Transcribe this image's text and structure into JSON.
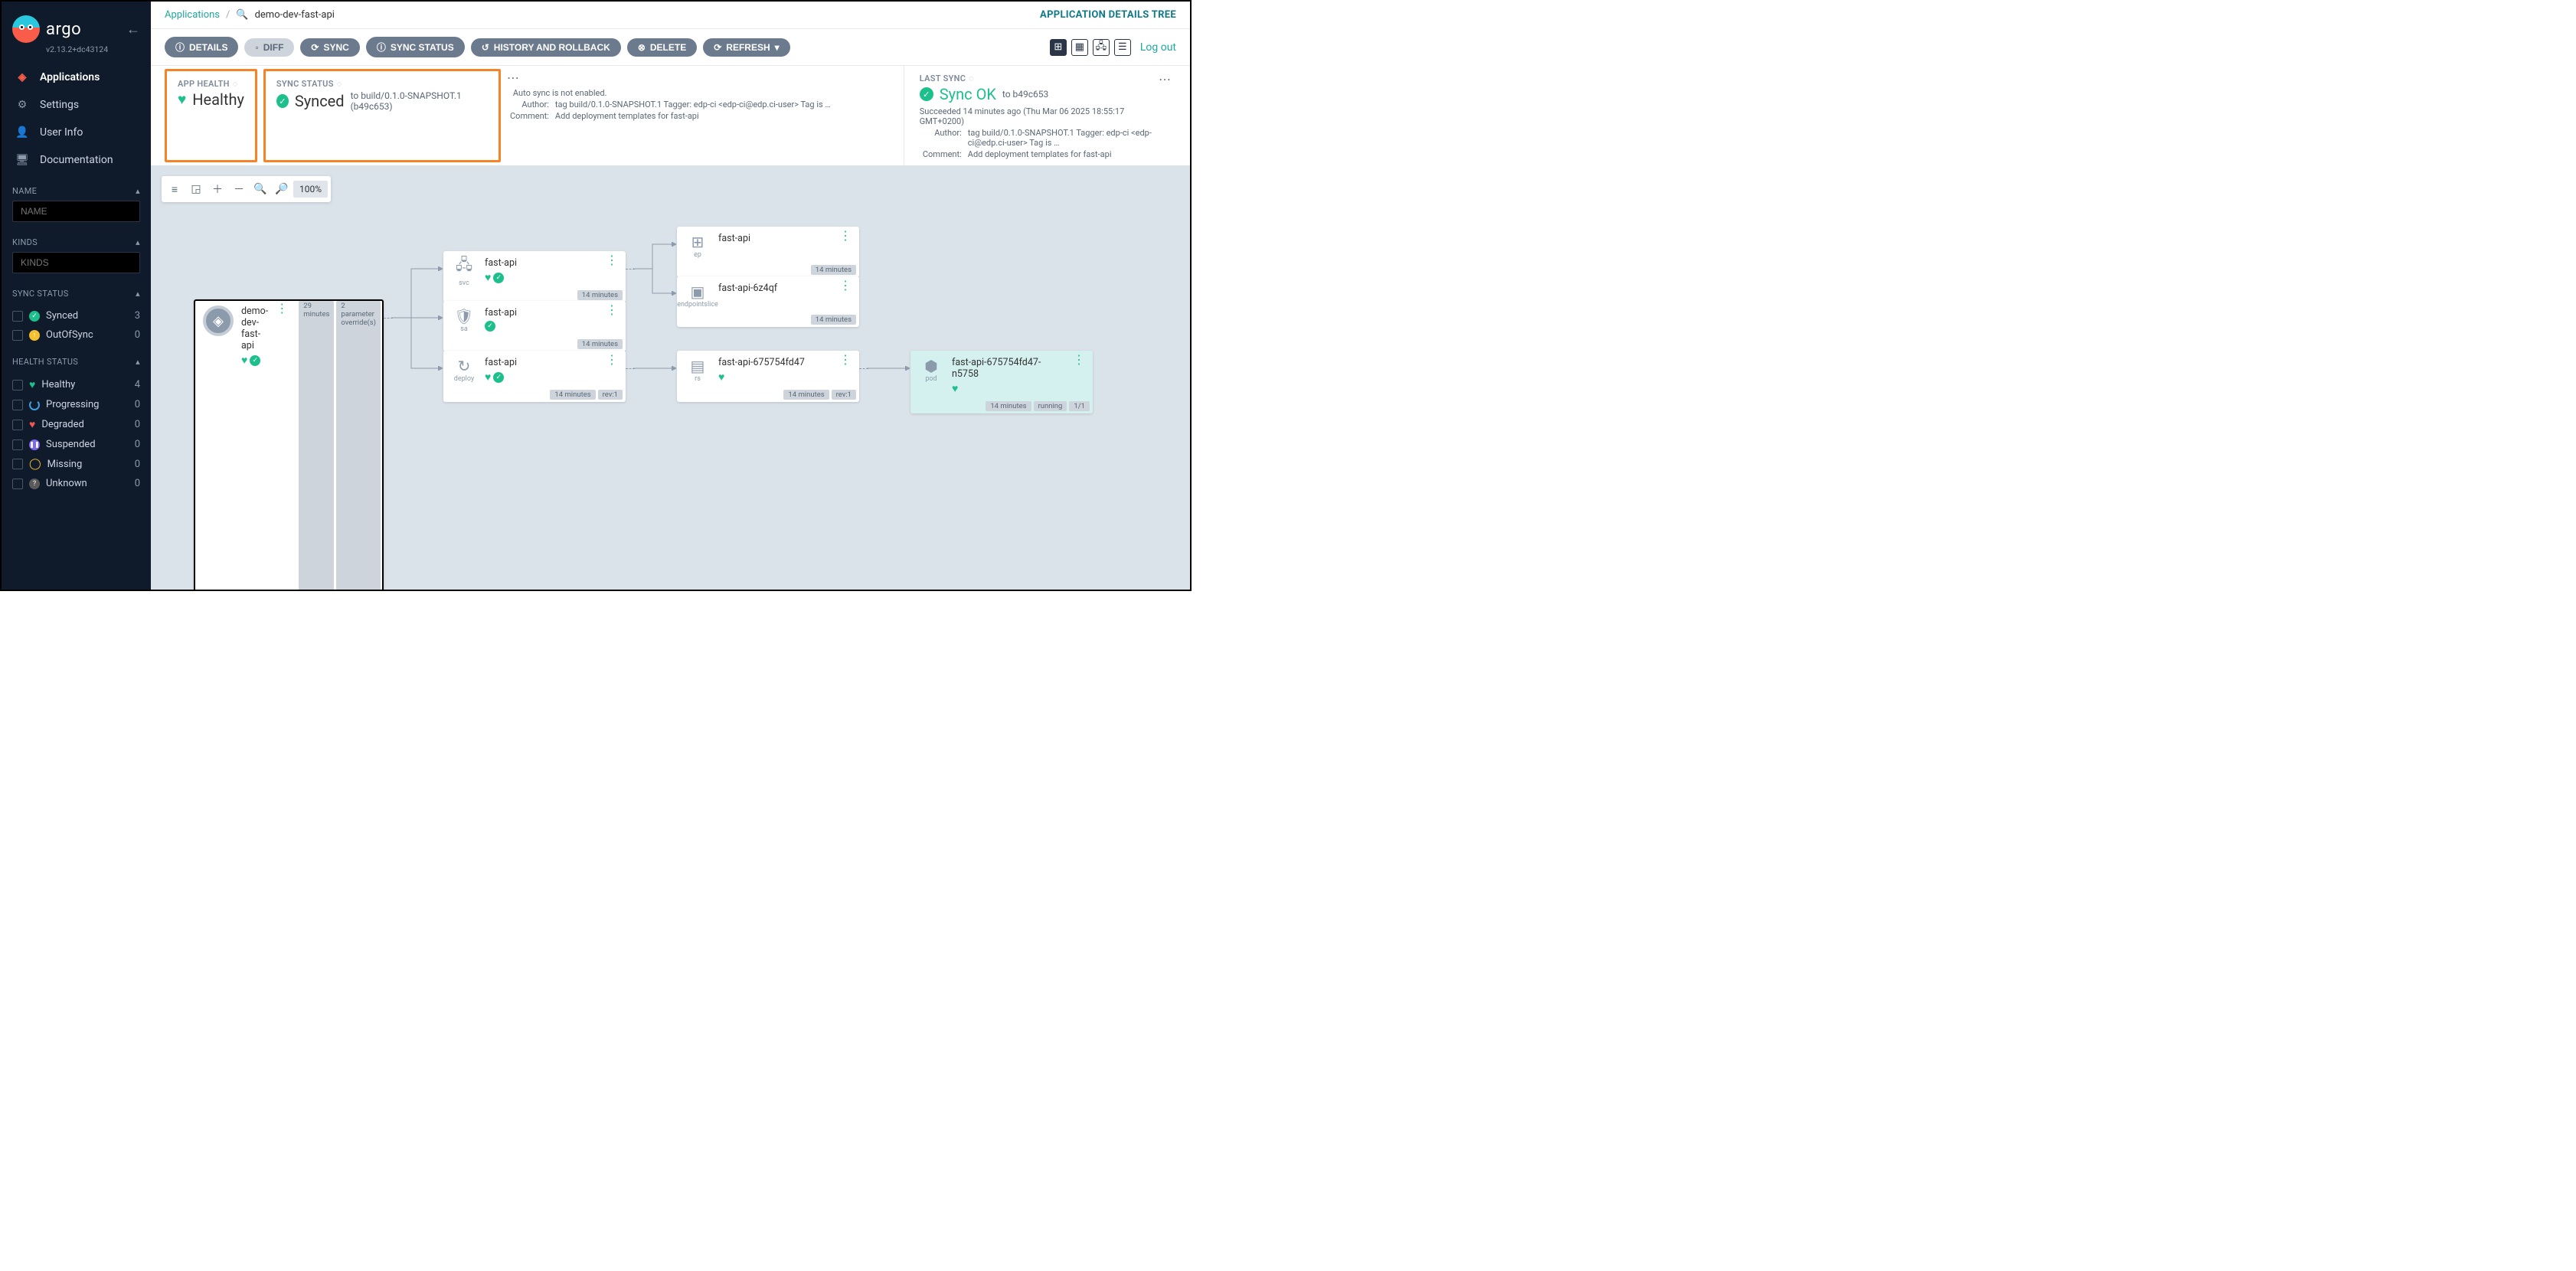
{
  "brand": {
    "name": "argo",
    "version": "v2.13.2+dc43124"
  },
  "nav": [
    {
      "icon": "layers-icon",
      "label": "Applications",
      "active": true
    },
    {
      "icon": "gear-icon",
      "label": "Settings"
    },
    {
      "icon": "user-icon",
      "label": "User Info"
    },
    {
      "icon": "doc-icon",
      "label": "Documentation"
    }
  ],
  "filters": {
    "name": {
      "header": "NAME",
      "placeholder": "NAME"
    },
    "kinds": {
      "header": "KINDS",
      "placeholder": "KINDS"
    },
    "sync": {
      "header": "SYNC STATUS",
      "items": [
        {
          "icon": "synced",
          "label": "Synced",
          "count": "3"
        },
        {
          "icon": "oos",
          "label": "OutOfSync",
          "count": "0"
        }
      ]
    },
    "health": {
      "header": "HEALTH STATUS",
      "items": [
        {
          "icon": "healthy",
          "label": "Healthy",
          "count": "4"
        },
        {
          "icon": "progressing",
          "label": "Progressing",
          "count": "0"
        },
        {
          "icon": "degraded",
          "label": "Degraded",
          "count": "0"
        },
        {
          "icon": "suspended",
          "label": "Suspended",
          "count": "0"
        },
        {
          "icon": "missing",
          "label": "Missing",
          "count": "0"
        },
        {
          "icon": "unknown",
          "label": "Unknown",
          "count": "0"
        }
      ]
    }
  },
  "breadcrumb": {
    "root": "Applications",
    "current": "demo-dev-fast-api"
  },
  "title": "APPLICATION DETAILS TREE",
  "actions": {
    "details": "DETAILS",
    "diff": "DIFF",
    "sync": "SYNC",
    "sync_status": "SYNC STATUS",
    "history": "HISTORY AND ROLLBACK",
    "delete": "DELETE",
    "refresh": "REFRESH"
  },
  "logout": "Log out",
  "status": {
    "health": {
      "label": "APP HEALTH",
      "value": "Healthy"
    },
    "sync": {
      "label": "SYNC STATUS",
      "value": "Synced",
      "to": "to build/0.1.0-SNAPSHOT.1 (b49c653)",
      "auto": "Auto sync is not enabled.",
      "author_k": "Author:",
      "author_v": "tag build/0.1.0-SNAPSHOT.1 Tagger: edp-ci <edp-ci@edp.ci-user> Tag is …",
      "comment_k": "Comment:",
      "comment_v": "Add deployment templates for fast-api"
    },
    "last": {
      "label": "LAST SYNC",
      "value": "Sync OK",
      "to": "to b49c653",
      "when": "Succeeded 14 minutes ago (Thu Mar 06 2025 18:55:17 GMT+0200)",
      "author_k": "Author:",
      "author_v": "tag build/0.1.0-SNAPSHOT.1 Tagger: edp-ci <edp-ci@edp.ci-user> Tag is …",
      "comment_k": "Comment:",
      "comment_v": "Add deployment templates for fast-api"
    }
  },
  "zoom": "100%",
  "nodes": {
    "app": {
      "name": "demo-dev-fast-api",
      "b1": "29 minutes",
      "b2": "2 parameter override(s)"
    },
    "svc": {
      "kind": "svc",
      "name": "fast-api",
      "b1": "14 minutes"
    },
    "sa": {
      "kind": "sa",
      "name": "fast-api",
      "b1": "14 minutes"
    },
    "deploy": {
      "kind": "deploy",
      "name": "fast-api",
      "b1": "14 minutes",
      "b2": "rev:1"
    },
    "ep": {
      "kind": "ep",
      "name": "fast-api",
      "b1": "14 minutes"
    },
    "eps": {
      "kind": "endpointslice",
      "name": "fast-api-6z4qf",
      "b1": "14 minutes"
    },
    "rs": {
      "kind": "rs",
      "name": "fast-api-675754fd47",
      "b1": "14 minutes",
      "b2": "rev:1"
    },
    "pod": {
      "kind": "pod",
      "name": "fast-api-675754fd47-n5758",
      "b1": "14 minutes",
      "b2": "running",
      "b3": "1/1"
    }
  }
}
